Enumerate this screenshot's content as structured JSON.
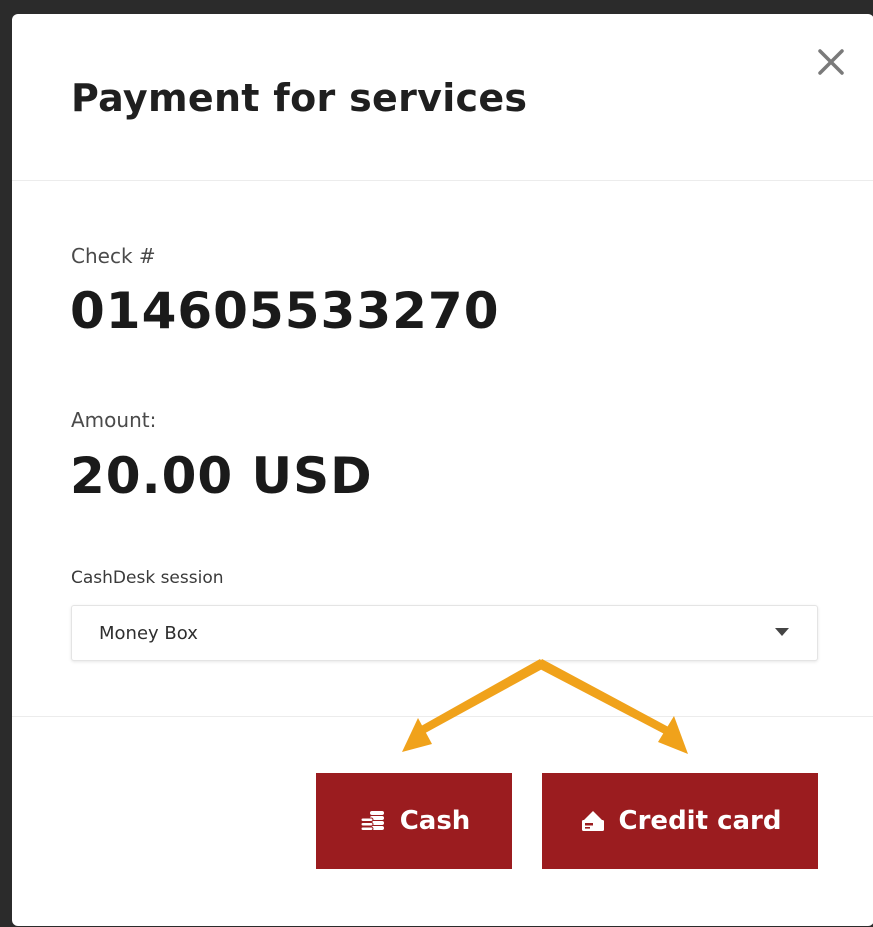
{
  "modal": {
    "title": "Payment for services",
    "close_icon": "close-icon"
  },
  "check": {
    "label": "Check #",
    "value": "014605533270"
  },
  "amount": {
    "label": "Amount:",
    "value": "20.00 USD"
  },
  "session": {
    "label": "CashDesk session",
    "selected": "Money Box"
  },
  "actions": {
    "cash_label": "Cash",
    "cash_icon": "coins-stack-icon",
    "card_label": "Credit card",
    "card_icon": "card-payment-icon"
  },
  "colors": {
    "primary_button": "#9b1c1f",
    "annotation_arrow": "#f0a21b"
  }
}
